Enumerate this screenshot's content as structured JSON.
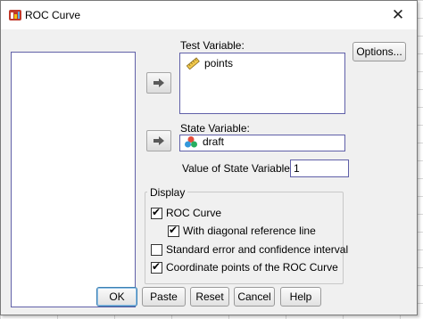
{
  "window": {
    "title": "ROC Curve",
    "close_glyph": "✕"
  },
  "icons": {
    "app": "spss-app-icon",
    "scale": "ruler-icon",
    "nominal": "nominal-variable-icon",
    "arrow": "arrow-right-icon"
  },
  "labels": {
    "test_variable": "Test Variable:",
    "state_variable": "State Variable:",
    "value_of_state": "Value of State Variable:"
  },
  "test_variable": {
    "items": [
      "points"
    ]
  },
  "state_variable": {
    "value": "draft"
  },
  "value_of_state": {
    "value": "1"
  },
  "display": {
    "title": "Display",
    "roc_curve": {
      "label": "ROC Curve",
      "checked": true
    },
    "diagonal": {
      "label": "With diagonal reference line",
      "checked": true
    },
    "std_error": {
      "label": "Standard error and confidence interval",
      "checked": false
    },
    "coord_points": {
      "label": "Coordinate points of the ROC Curve",
      "checked": true
    }
  },
  "buttons": {
    "options": "Options...",
    "ok": "OK",
    "paste": "Paste",
    "reset": "Reset",
    "cancel": "Cancel",
    "help": "Help"
  },
  "colors": {
    "list_border": "#6060a8",
    "focus": "#3c7fb1"
  }
}
